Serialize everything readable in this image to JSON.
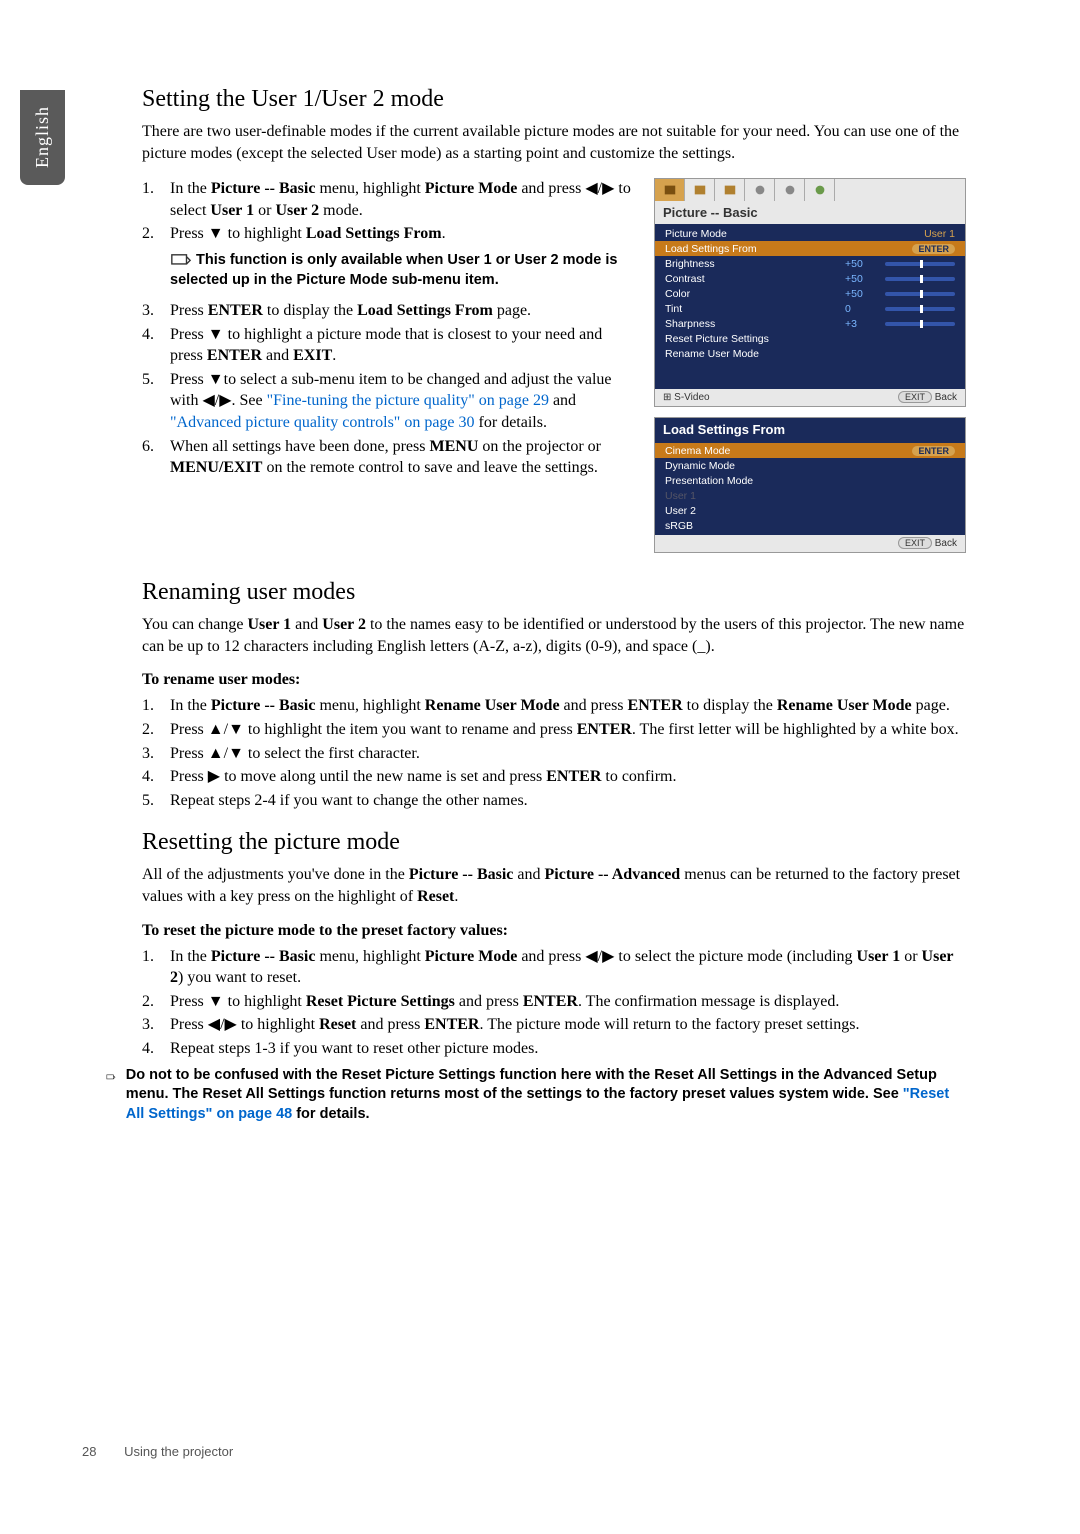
{
  "sideTab": "English",
  "s1": {
    "title": "Setting the User 1/User 2 mode",
    "intro": "There are two user-definable modes if the current available picture modes are not suitable for your need. You can use one of the picture modes (except the selected User mode) as a starting point and customize the settings.",
    "li1a": "In the ",
    "li1b": "Picture -- Basic",
    "li1c": " menu, highlight ",
    "li1d": "Picture Mode",
    "li1e": " and press ◀/▶ to select ",
    "li1f": "User 1",
    "li1g": " or ",
    "li1h": "User 2",
    "li1i": " mode.",
    "li2a": "Press ▼  to highlight ",
    "li2b": "Load Settings From",
    "li2c": ".",
    "note": "This function is only available when User 1 or User 2 mode is selected up in the Picture Mode sub-menu item.",
    "li3a": "Press ",
    "li3b": "ENTER",
    "li3c": " to display the ",
    "li3d": "Load Settings From",
    "li3e": " page.",
    "li4a": "Press ▼ to highlight a picture mode that is closest to your need and press ",
    "li4b": "ENTER",
    "li4c": " and ",
    "li4d": "EXIT",
    "li4e": ".",
    "li5a": "Press ▼to select a sub-menu item to be changed and adjust the value with ◀/▶. See ",
    "li5link1": "\"Fine-tuning the picture quality\" on page 29",
    "li5mid": " and ",
    "li5link2": "\"Advanced picture quality controls\" on page 30",
    "li5end": " for details.",
    "li6a": "When all settings have been done, press ",
    "li6b": "MENU",
    "li6c": " on the projector or ",
    "li6d": "MENU/EXIT",
    "li6e": " on the remote control to save and leave the settings."
  },
  "osd1": {
    "title": "Picture -- Basic",
    "rows": [
      {
        "label": "Picture Mode",
        "value": "",
        "extra": "User 1"
      },
      {
        "label": "Load Settings From",
        "value": "",
        "extra": "ENTER"
      },
      {
        "label": "Brightness",
        "value": "+50"
      },
      {
        "label": "Contrast",
        "value": "+50"
      },
      {
        "label": "Color",
        "value": "+50"
      },
      {
        "label": "Tint",
        "value": "0"
      },
      {
        "label": "Sharpness",
        "value": "+3"
      },
      {
        "label": "Reset Picture Settings",
        "value": ""
      },
      {
        "label": "Rename User Mode",
        "value": ""
      }
    ],
    "footerLeft": "S-Video",
    "footerRight": "Back",
    "footerExit": "EXIT"
  },
  "osd2": {
    "title": "Load Settings From",
    "rows": [
      {
        "label": "Cinema Mode",
        "extra": "ENTER"
      },
      {
        "label": "Dynamic Mode"
      },
      {
        "label": "Presentation Mode"
      },
      {
        "label": "User 1"
      },
      {
        "label": "User 2"
      },
      {
        "label": "sRGB"
      }
    ],
    "footerRight": "Back",
    "footerExit": "EXIT"
  },
  "s2": {
    "title": "Renaming user modes",
    "p1a": "You can change ",
    "p1b": "User 1",
    "p1c": " and ",
    "p1d": "User 2",
    "p1e": " to the names easy to be identified or understood by the users of this projector. The new name can be up to 12 characters including English letters (A-Z, a-z), digits (0-9), and space (_).",
    "sub": "To rename user modes:",
    "li1a": "In the ",
    "li1b": "Picture -- Basic",
    "li1c": " menu, highlight ",
    "li1d": "Rename User Mode",
    "li1e": " and press ",
    "li1f": "ENTER",
    "li1g": " to display the ",
    "li1h": "Rename User Mode",
    "li1i": " page.",
    "li2a": "Press ▲/▼ to highlight the item you want to rename and press ",
    "li2b": "ENTER",
    "li2c": ". The first letter will be highlighted by a white box.",
    "li3": "Press ▲/▼ to select the first character.",
    "li4a": "Press ▶ to move along until the new name is set and press ",
    "li4b": "ENTER",
    "li4c": " to confirm.",
    "li5": "Repeat steps 2-4 if you want to change the other names."
  },
  "s3": {
    "title": "Resetting the picture mode",
    "p1a": "All of the adjustments you've done in the ",
    "p1b": "Picture -- Basic",
    "p1c": " and ",
    "p1d": "Picture -- Advanced",
    "p1e": " menus can be returned to the factory preset values with a key press on the highlight of ",
    "p1f": "Reset",
    "p1g": ".",
    "sub": "To reset the picture mode to the preset factory values:",
    "li1a": "In the ",
    "li1b": "Picture -- Basic",
    "li1c": " menu, highlight ",
    "li1d": "Picture Mode",
    "li1e": " and press ◀/▶ to select the picture mode (including ",
    "li1f": "User 1",
    "li1g": " or ",
    "li1h": "User 2",
    "li1i": ") you want to reset.",
    "li2a": "Press ▼ to highlight ",
    "li2b": "Reset Picture Settings",
    "li2c": " and press ",
    "li2d": "ENTER",
    "li2e": ". The confirmation message is displayed.",
    "li3a": "Press ◀/▶ to highlight ",
    "li3b": "Reset",
    "li3c": " and press ",
    "li3d": "ENTER",
    "li3e": ". The picture mode will return to the factory preset settings.",
    "li4": "Repeat steps 1-3 if you want to reset other picture modes.",
    "note1": "Do not to be confused with the Reset Picture Settings function here with the Reset All Settings in the Advanced Setup menu. The Reset All Settings function returns most of the settings to the factory preset values system wide. See ",
    "noteLink": "\"Reset All Settings\" on page 48",
    "note2": " for details."
  },
  "footer": {
    "page": "28",
    "label": "Using the projector"
  }
}
